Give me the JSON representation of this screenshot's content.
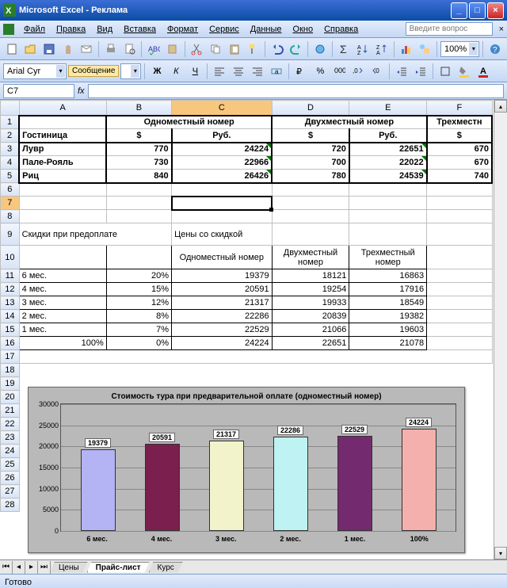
{
  "window": {
    "app": "Microsoft Excel",
    "doc": "Реклама"
  },
  "menu": {
    "file": "Файл",
    "edit": "Правка",
    "view": "Вид",
    "insert": "Вставка",
    "format": "Формат",
    "tools": "Сервис",
    "data": "Данные",
    "window": "Окно",
    "help": "Справка",
    "ask": "Введите вопрос"
  },
  "toolbar": {
    "zoom": "100%",
    "font": "Arial Cyr",
    "size": "",
    "msg": "Сообщение"
  },
  "fbar": {
    "cell": "C7",
    "fx": "fx"
  },
  "cols": [
    "A",
    "B",
    "C",
    "D",
    "E",
    "F"
  ],
  "head": {
    "single": "Одноместный номер",
    "double": "Двухместный номер",
    "triple": "Трехместн",
    "hotel": "Гостиница",
    "usd": "$",
    "rub": "Руб."
  },
  "hotels": [
    {
      "name": "Лувр",
      "s_usd": "770",
      "s_rub": "24224",
      "d_usd": "720",
      "d_rub": "22651",
      "t_usd": "670"
    },
    {
      "name": "Пале-Рояль",
      "s_usd": "730",
      "s_rub": "22966",
      "d_usd": "700",
      "d_rub": "22022",
      "t_usd": "670"
    },
    {
      "name": "Риц",
      "s_usd": "840",
      "s_rub": "26426",
      "d_usd": "780",
      "d_rub": "24539",
      "t_usd": "740"
    }
  ],
  "disc": {
    "title": "Скидки при предоплате",
    "prices": "Цены со скидкой",
    "hsingle": "Одноместный номер",
    "hdouble": "Двухместный номер",
    "htriple": "Трехместный номер"
  },
  "discrows": [
    {
      "p": "6 мес.",
      "pct": "20%",
      "s": "19379",
      "d": "18121",
      "t": "16863"
    },
    {
      "p": "4 мес.",
      "pct": "15%",
      "s": "20591",
      "d": "19254",
      "t": "17916"
    },
    {
      "p": "3 мес.",
      "pct": "12%",
      "s": "21317",
      "d": "19933",
      "t": "18549"
    },
    {
      "p": "2 мес.",
      "pct": "8%",
      "s": "22286",
      "d": "20839",
      "t": "19382"
    },
    {
      "p": "1 мес.",
      "pct": "7%",
      "s": "22529",
      "d": "21066",
      "t": "19603"
    },
    {
      "p": "100%",
      "pct": "0%",
      "s": "24224",
      "d": "22651",
      "t": "21078"
    }
  ],
  "chart_data": {
    "type": "bar",
    "title": "Стоимость тура при предварительной оплате (одноместный номер)",
    "categories": [
      "6 мес.",
      "4 мес.",
      "3 мес.",
      "2 мес.",
      "1 мес.",
      "100%"
    ],
    "values": [
      19379,
      20591,
      21317,
      22286,
      22529,
      24224
    ],
    "ylim": [
      0,
      30000
    ],
    "yticks": [
      0,
      5000,
      10000,
      15000,
      20000,
      25000,
      30000
    ],
    "colors": [
      "#b4b4f4",
      "#7a1f4e",
      "#f2f2cb",
      "#bff2f2",
      "#742a6f",
      "#f4b0ac"
    ]
  },
  "tabs": {
    "t1": "Цены",
    "t2": "Прайс-лист",
    "t3": "Курс"
  },
  "status": {
    "ready": "Готово"
  }
}
